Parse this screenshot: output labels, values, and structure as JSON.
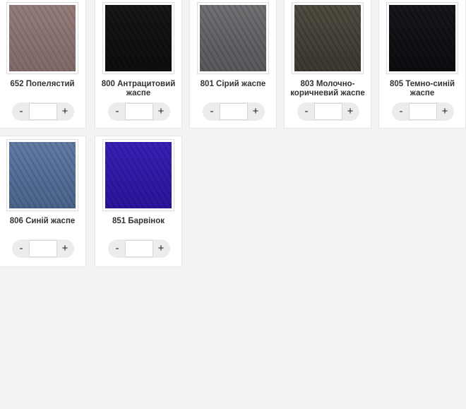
{
  "products": [
    {
      "label": "652 Попелястий",
      "color_a": "#c2b2b0",
      "color_b": "#a89897",
      "quantity": ""
    },
    {
      "label": "800 Антрацитовий жаспе",
      "color_a": "#4d4d4b",
      "color_b": "#2e2e2e",
      "quantity": ""
    },
    {
      "label": "801 Сірий жаспе",
      "color_a": "#a9a9ab",
      "color_b": "#86868a",
      "quantity": ""
    },
    {
      "label": "803 Молочно-коричневий жаспе",
      "color_a": "#8f8b81",
      "color_b": "#6b685f",
      "quantity": ""
    },
    {
      "label": "805 Темно-синій жаспе",
      "color_a": "#4c4c55",
      "color_b": "#2c2c33",
      "quantity": ""
    },
    {
      "label": "806 Синій жаспе",
      "color_a": "#9db1cc",
      "color_b": "#7a90ad",
      "quantity": ""
    },
    {
      "label": "851 Барвінок",
      "color_a": "#7a5ad6",
      "color_b": "#5b3db7",
      "quantity": ""
    }
  ],
  "controls": {
    "minus_label": "-",
    "plus_label": "+"
  }
}
